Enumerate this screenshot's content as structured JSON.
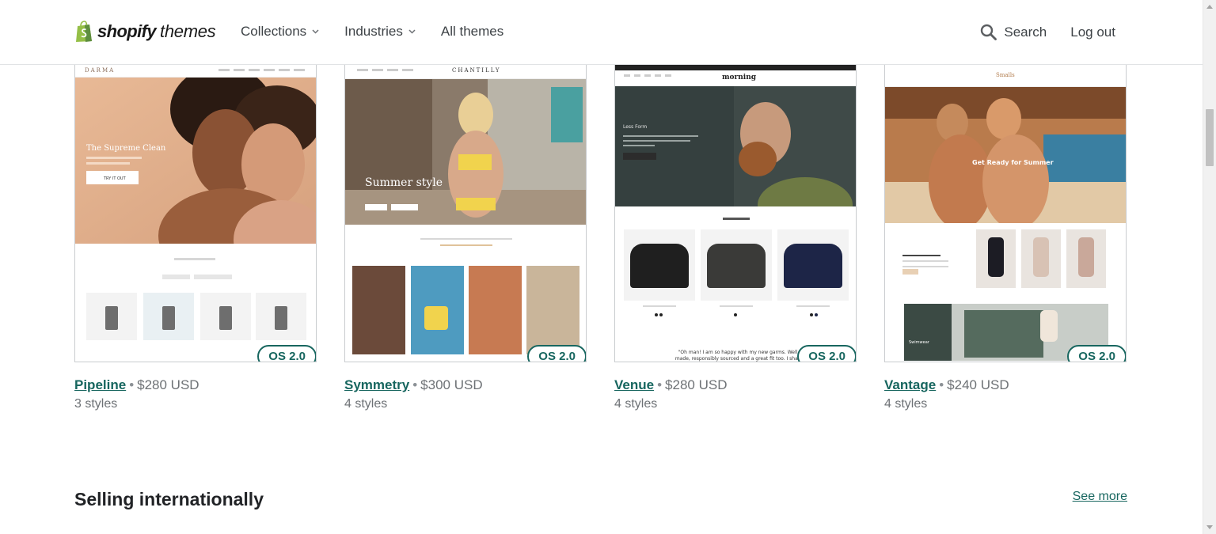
{
  "header": {
    "logo_word": "shopify",
    "logo_sub": "themes",
    "nav": [
      {
        "label": "Collections",
        "has_dropdown": true
      },
      {
        "label": "Industries",
        "has_dropdown": true
      },
      {
        "label": "All themes",
        "has_dropdown": false
      }
    ],
    "search_label": "Search",
    "logout_label": "Log out"
  },
  "themes": [
    {
      "name": "Pipeline",
      "price": "$280 USD",
      "styles": "3 styles",
      "badge": "OS 2.0",
      "preview": {
        "brand": "DARMA",
        "headline": "The Supreme Clean",
        "cta": "TRY IT OUT",
        "section_label": "FEATURED COLLECTIONS"
      }
    },
    {
      "name": "Symmetry",
      "price": "$300 USD",
      "styles": "4 styles",
      "badge": "OS 2.0",
      "preview": {
        "brand": "CHANTILLY",
        "headline": "Summer style",
        "cta": "SHOP NOW",
        "section_label": "This is a demonstration of the Symmetry theme for Shopify."
      }
    },
    {
      "name": "Venue",
      "price": "$280 USD",
      "styles": "4 styles",
      "badge": "OS 2.0",
      "preview": {
        "brand": "morning",
        "headline": "Less Form",
        "cta": "SHOP COLLECTION",
        "section_label": "New Season",
        "products": [
          "Periwinkle Fleece",
          "Home Tee",
          "Slender Lines"
        ],
        "quote": "\"Oh man! I am so happy with my new garms. Well made, responsibly sourced and a great fit too. I shall"
      }
    },
    {
      "name": "Vantage",
      "price": "$240 USD",
      "styles": "4 styles",
      "badge": "OS 2.0",
      "preview": {
        "brand": "Smalls",
        "headline": "Get Ready for Summer",
        "section_label": "In with the New",
        "banner": "Swimwear"
      }
    }
  ],
  "section": {
    "title": "Selling internationally",
    "see_more": "See more"
  },
  "colors": {
    "accent": "#17665f",
    "text": "#212326",
    "muted": "#6d7175",
    "logo_green": "#95bf47"
  }
}
